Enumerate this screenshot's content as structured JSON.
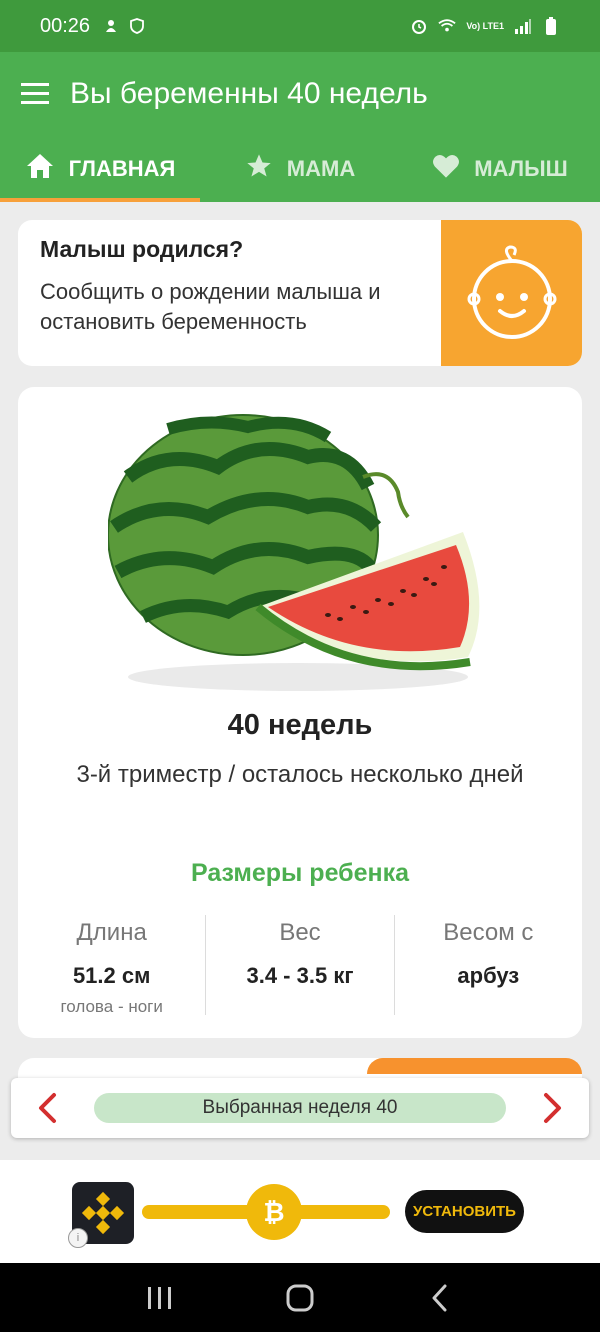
{
  "status_bar": {
    "time": "00:26",
    "network_label": "Vo) LTE1",
    "icons": [
      "notification-icon",
      "shield-icon",
      "alarm-icon",
      "wifi-icon",
      "signal-icon",
      "battery-icon"
    ]
  },
  "app_bar": {
    "title": "Вы беременны 40 недель",
    "menu_icon": "hamburger-menu-icon"
  },
  "tabs": [
    {
      "label": "ГЛАВНАЯ",
      "icon": "home-icon",
      "active": true
    },
    {
      "label": "МАМА",
      "icon": "star-icon",
      "active": false
    },
    {
      "label": "МАЛЫШ",
      "icon": "heart-icon",
      "active": false
    }
  ],
  "born_card": {
    "title": "Малыш родился?",
    "description": "Сообщить о рождении малыша и остановить беременность",
    "icon": "baby-face-icon"
  },
  "week_card": {
    "image": "watermelon-illustration",
    "title": "40 недель",
    "subtitle": "3-й триместр / осталось несколько дней",
    "sizes_title": "Размеры ребенка",
    "stats": [
      {
        "label": "Длина",
        "value": "51.2 см",
        "note": "голова - ноги"
      },
      {
        "label": "Вес",
        "value": "3.4 - 3.5 кг",
        "note": ""
      },
      {
        "label": "Весом с",
        "value": "арбуз",
        "note": ""
      }
    ]
  },
  "week_selector": {
    "label": "Выбранная неделя 40",
    "prev_icon": "chevron-left-icon",
    "next_icon": "chevron-right-icon"
  },
  "ad_banner": {
    "install_label": "УСТАНОВИТЬ",
    "coin_symbol": "₿",
    "info_symbol": "i"
  },
  "colors": {
    "status_bar": "#3f9a3d",
    "primary": "#4caf50",
    "accent_orange": "#f7a530",
    "arrow_red": "#d32f2f",
    "pill_green": "#c8e6c9",
    "ad_yellow": "#f0b90b"
  }
}
